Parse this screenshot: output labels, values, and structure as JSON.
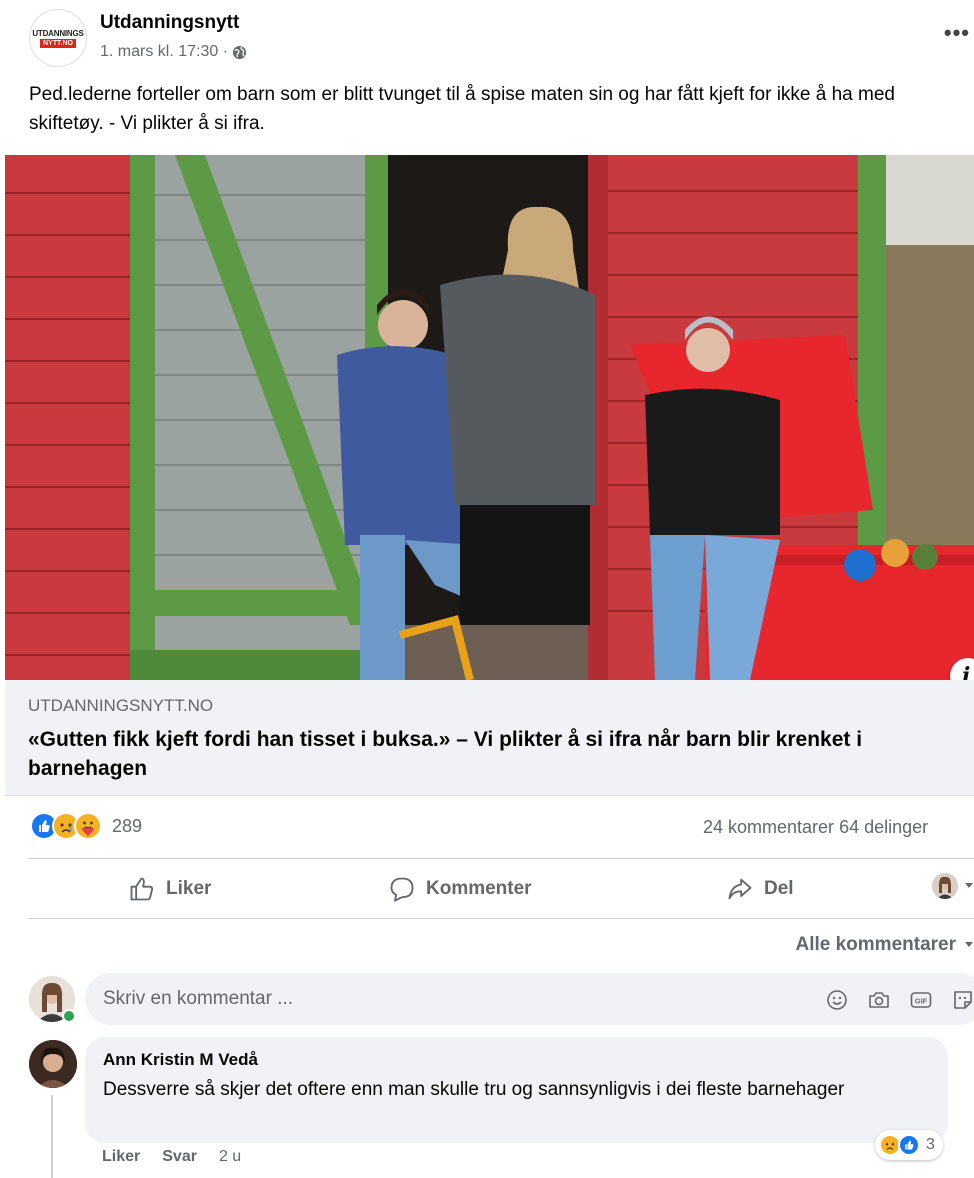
{
  "post": {
    "page_logo": {
      "line1": "UTDANNINGS",
      "line2": "NYTT.NO"
    },
    "page_name": "Utdanningsnytt",
    "timestamp": "1. mars kl. 17:30 ·",
    "more_label": "•••",
    "text": "Ped.lederne forteller om barn som er blitt tvunget til å spise maten sin og har fått kjeft for ikke å ha med skiftetøy. - Vi plikter å si ifra.",
    "info_label": "i"
  },
  "link": {
    "domain": "UTDANNINGSNYTT.NO",
    "title": "«Gutten fikk kjeft fordi han tisset i buksa.» – Vi plikter å si ifra når barn blir krenket i barnehagen"
  },
  "stats": {
    "reaction_count": "289",
    "reaction_icons": [
      "like-icon",
      "sad-icon",
      "care-icon"
    ],
    "comments": "24 kommentarer",
    "shares": "64 delinger"
  },
  "actions": {
    "like": "Liker",
    "comment": "Kommenter",
    "share": "Del"
  },
  "comments_filter": "Alle kommentarer",
  "composer": {
    "placeholder": "Skriv en kommentar ..."
  },
  "comment": {
    "author": "Ann Kristin M Vedå",
    "text": "Dessverre så skjer det oftere enn man skulle tru og sannsynligvis i dei fleste barnehager",
    "reaction_count": "3",
    "like_label": "Liker",
    "reply_label": "Svar",
    "time": "2 u"
  },
  "colors": {
    "accent": "#1877f2",
    "secondary_text": "#65676b",
    "link_box_bg": "#f0f2f5",
    "shed_red": "#c8383d",
    "shed_green": "#5d9a45",
    "bin_red": "#e8262d"
  }
}
